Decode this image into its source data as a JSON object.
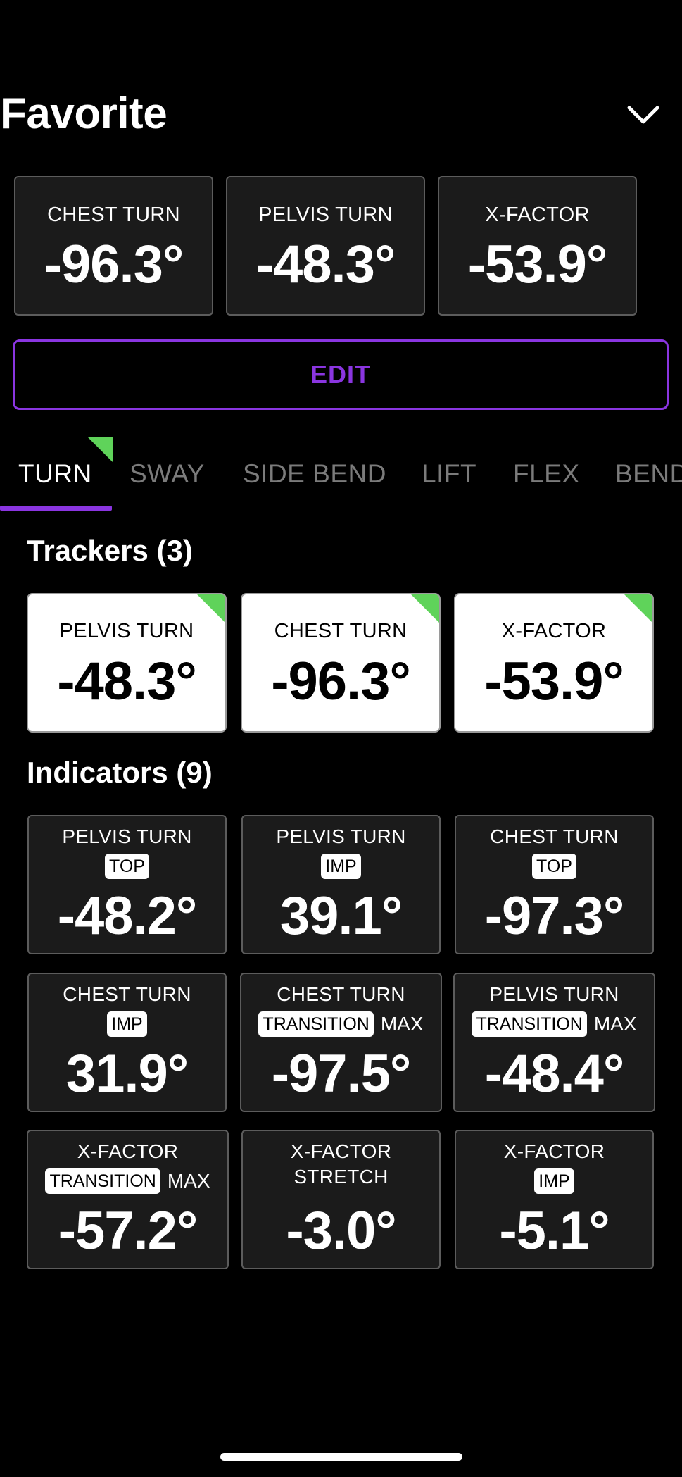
{
  "header": {
    "title": "Favorite",
    "chevron_icon": "chevron-down-icon"
  },
  "favorites": [
    {
      "label": "CHEST TURN",
      "value": "-96.3°"
    },
    {
      "label": "PELVIS TURN",
      "value": "-48.3°"
    },
    {
      "label": "X-FACTOR",
      "value": "-53.9°"
    }
  ],
  "edit": {
    "label": "EDIT"
  },
  "tabs": [
    {
      "label": "TURN",
      "active": true
    },
    {
      "label": "SWAY"
    },
    {
      "label": "SIDE BEND"
    },
    {
      "label": "LIFT"
    },
    {
      "label": "FLEX"
    },
    {
      "label": "BEND"
    }
  ],
  "trackers": {
    "title": "Trackers (3)",
    "items": [
      {
        "label": "PELVIS TURN",
        "value": "-48.3°"
      },
      {
        "label": "CHEST TURN",
        "value": "-96.3°"
      },
      {
        "label": "X-FACTOR",
        "value": "-53.9°"
      }
    ]
  },
  "indicators": {
    "title": "Indicators (9)",
    "items": [
      {
        "label": "PELVIS TURN",
        "pill": "TOP",
        "value": "-48.2°"
      },
      {
        "label": "PELVIS TURN",
        "pill": "IMP",
        "value": "39.1°"
      },
      {
        "label": "CHEST TURN",
        "pill": "TOP",
        "value": "-97.3°"
      },
      {
        "label": "CHEST TURN",
        "pill": "IMP",
        "value": "31.9°"
      },
      {
        "label": "CHEST TURN",
        "pill": "TRANSITION",
        "suffix": "MAX",
        "value": "-97.5°"
      },
      {
        "label": "PELVIS TURN",
        "pill": "TRANSITION",
        "suffix": "MAX",
        "value": "-48.4°"
      },
      {
        "label": "X-FACTOR",
        "pill": "TRANSITION",
        "suffix": "MAX",
        "value": "-57.2°"
      },
      {
        "label": "X-FACTOR",
        "label2": "STRETCH",
        "value": "-3.0°"
      },
      {
        "label": "X-FACTOR",
        "pill": "IMP",
        "value": "-5.1°"
      }
    ]
  },
  "colors": {
    "accent": "#8a35e0",
    "flag": "#5fd35a",
    "card_bg": "#1b1b1b"
  }
}
